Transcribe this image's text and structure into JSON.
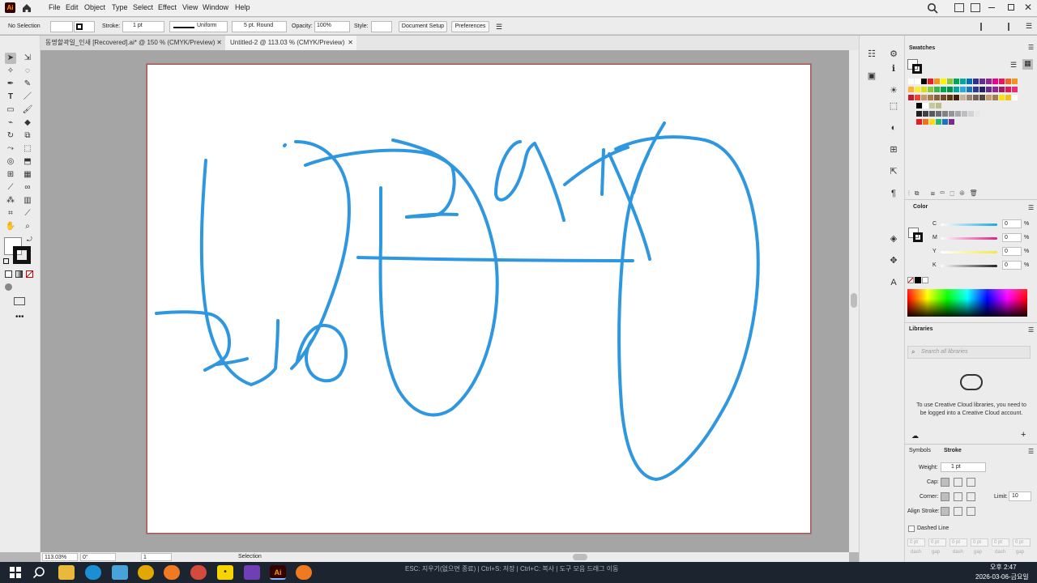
{
  "app": {
    "logo": "Ai",
    "home_icon": "home-icon"
  },
  "menu": [
    "File",
    "Edit",
    "Object",
    "Type",
    "Select",
    "Effect",
    "View",
    "Window",
    "Help"
  ],
  "control": {
    "selection": "No Selection",
    "stroke_label": "Stroke:",
    "stroke_value": "1 pt",
    "profile": "Uniform",
    "brush": "5 pt. Round",
    "opacity_label": "Opacity:",
    "opacity_value": "100%",
    "style_label": "Style:",
    "doc_setup": "Document Setup",
    "preferences": "Preferences"
  },
  "tabs": [
    {
      "label": "동명할곽일_인새 [Recovered].ai* @ 150 % (CMYK/Preview)",
      "active": false
    },
    {
      "label": "Untitled-2 @ 113.03 % (CMYK/Preview)",
      "active": true
    }
  ],
  "status": {
    "zoom": "113.03%",
    "rotate": "0°",
    "artboard": "1",
    "tool": "Selection"
  },
  "hint": "ESC: 지우기(없으면 종료) | Ctrl+S: 저장 | Ctrl+C: 복사 | 도구 모음 드래그 이동",
  "panels": {
    "swatches": {
      "title": "Swatches"
    },
    "color": {
      "title": "Color",
      "channels": [
        {
          "label": "C",
          "value": "0",
          "color": "#1aa9e1"
        },
        {
          "label": "M",
          "value": "0",
          "color": "#e0218a"
        },
        {
          "label": "Y",
          "value": "0",
          "color": "#f4e842"
        },
        {
          "label": "K",
          "value": "0",
          "color": "#222222"
        }
      ]
    },
    "libraries": {
      "title": "Libraries",
      "search_placeholder": "Search all libraries",
      "message": "To use Creative Cloud libraries, you need to be logged into a Creative Cloud account."
    },
    "symbols_tab": "Symbols",
    "stroke": {
      "title": "Stroke",
      "weight_label": "Weight:",
      "weight_value": "1 pt",
      "cap_label": "Cap:",
      "corner_label": "Corner:",
      "limit_label": "Limit:",
      "limit_value": "10",
      "align_label": "Align Stroke:",
      "dashed_label": "Dashed Line",
      "dash_gap": [
        "dash",
        "gap",
        "dash",
        "gap",
        "dash",
        "gap"
      ],
      "dash_values": [
        "0 pt",
        "0 pt",
        "0 pt",
        "0 pt",
        "0 pt",
        "0 pt"
      ]
    }
  },
  "taskbar": {
    "time": "오후 2:47",
    "date": "2026-03-06-금요일"
  },
  "stroke_color": "#2f97e0",
  "artboard_border": "#c84a4a"
}
